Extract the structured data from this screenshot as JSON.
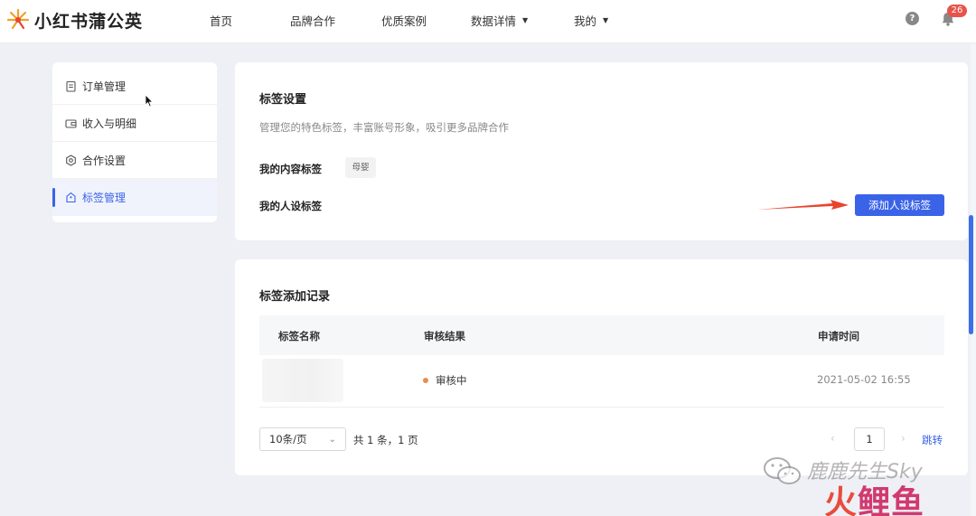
{
  "brand": {
    "name": "小红书蒲公英",
    "logo_icon": "dandelion-icon"
  },
  "nav": {
    "items": [
      {
        "label": "首页",
        "dropdown": false
      },
      {
        "label": "品牌合作",
        "dropdown": false
      },
      {
        "label": "优质案例",
        "dropdown": false
      },
      {
        "label": "数据详情",
        "dropdown": true
      },
      {
        "label": "我的",
        "dropdown": true
      }
    ],
    "help_icon": "question-icon",
    "help_glyph": "?",
    "notifications": {
      "icon": "bell-icon",
      "count": "26"
    }
  },
  "sidebar": {
    "items": [
      {
        "label": "订单管理",
        "icon": "clipboard-icon",
        "active": false
      },
      {
        "label": "收入与明细",
        "icon": "wallet-icon",
        "active": false
      },
      {
        "label": "合作设置",
        "icon": "gear-icon",
        "active": false
      },
      {
        "label": "标签管理",
        "icon": "tag-icon",
        "active": true
      }
    ]
  },
  "tag_settings": {
    "title": "标签设置",
    "description": "管理您的特色标签，丰富账号形象，吸引更多品牌合作",
    "content_tags_label": "我的内容标签",
    "content_tags": [
      "母婴"
    ],
    "persona_tags_label": "我的人设标签",
    "add_persona_button": "添加人设标签"
  },
  "tag_records": {
    "title": "标签添加记录",
    "columns": [
      "标签名称",
      "审核结果",
      "申请时间"
    ],
    "rows": [
      {
        "name": "",
        "status": "审核中",
        "time": "2021-05-02 16:55"
      }
    ],
    "pagination": {
      "page_size": "10条/页",
      "total": "共 1 条，1 页",
      "prev": "‹",
      "next": "›",
      "current_page": "1",
      "jump": "跳转"
    }
  },
  "colors": {
    "accent": "#3b63e8",
    "status_pending": "#e78d4f",
    "arrow": "#e8452f"
  },
  "watermark": {
    "text": "鹿鹿先生Sky",
    "logo_a": "火",
    "logo_b": "鲤鱼"
  }
}
